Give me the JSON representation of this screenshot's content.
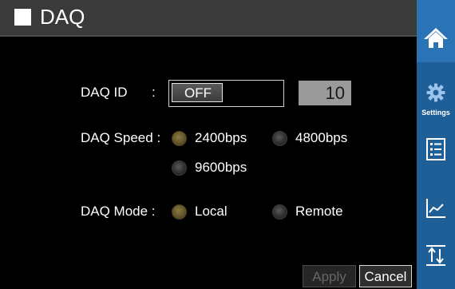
{
  "header": {
    "title": "DAQ"
  },
  "form": {
    "daq_id_label": "DAQ ID",
    "daq_id_colon": ":",
    "daq_id_toggle": "OFF",
    "daq_id_value": "10",
    "speed_label": "DAQ Speed :",
    "speed_options": [
      {
        "label": "2400bps",
        "selected": true
      },
      {
        "label": "4800bps",
        "selected": false
      },
      {
        "label": "9600bps",
        "selected": false
      }
    ],
    "mode_label": "DAQ Mode :",
    "mode_options": [
      {
        "label": "Local",
        "selected": true
      },
      {
        "label": "Remote",
        "selected": false
      }
    ]
  },
  "footer": {
    "apply_label": "Apply",
    "cancel_label": "Cancel",
    "apply_enabled": false
  },
  "sidebar": {
    "items": [
      {
        "icon": "home-icon",
        "label": ""
      },
      {
        "icon": "gear-icon",
        "label": "Settings"
      },
      {
        "icon": "list-icon",
        "label": ""
      },
      {
        "icon": "chart-icon",
        "label": ""
      },
      {
        "icon": "sort-icon",
        "label": ""
      }
    ]
  },
  "colors": {
    "sidebar": "#1f5f98",
    "sidebar_active": "#2a73b4",
    "radio_selected": "#7a6a35",
    "titlebar": "#3a3a3a"
  }
}
